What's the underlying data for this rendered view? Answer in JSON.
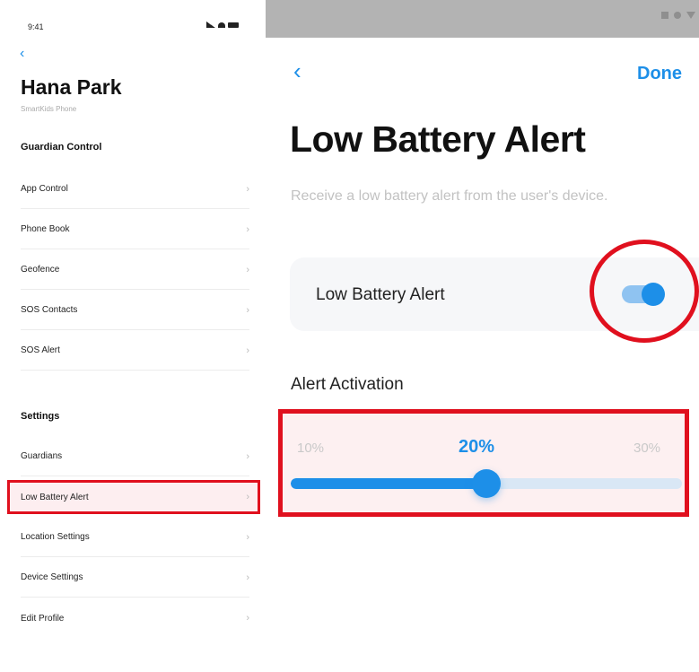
{
  "left": {
    "status_time": "9:41",
    "back_icon": "chevron-left-icon",
    "profile_name": "Hana Park",
    "profile_sub": "SmartKids Phone",
    "guardian_title": "Guardian Control",
    "guardian_items": [
      {
        "label": "App Control"
      },
      {
        "label": "Phone Book"
      },
      {
        "label": "Geofence"
      },
      {
        "label": "SOS Contacts"
      },
      {
        "label": "SOS Alert"
      }
    ],
    "settings_title": "Settings",
    "settings_items": [
      {
        "label": "Guardians"
      },
      {
        "label": "Low Battery Alert",
        "selected": true
      },
      {
        "label": "Location Settings"
      },
      {
        "label": "Device Settings"
      },
      {
        "label": "Edit Profile"
      }
    ],
    "chevron": "›"
  },
  "right": {
    "back_glyph": "‹",
    "done_label": "Done",
    "title": "Low Battery Alert",
    "description": "Receive a low battery alert from the user's device.",
    "toggle_label": "Low Battery Alert",
    "toggle_on": true,
    "section_label": "Alert Activation",
    "slider": {
      "min_label": "10%",
      "value_label": "20%",
      "max_label": "30%",
      "value_fraction": 0.5
    }
  },
  "colors": {
    "accent": "#1d8fe8",
    "highlight": "#e0101e"
  }
}
